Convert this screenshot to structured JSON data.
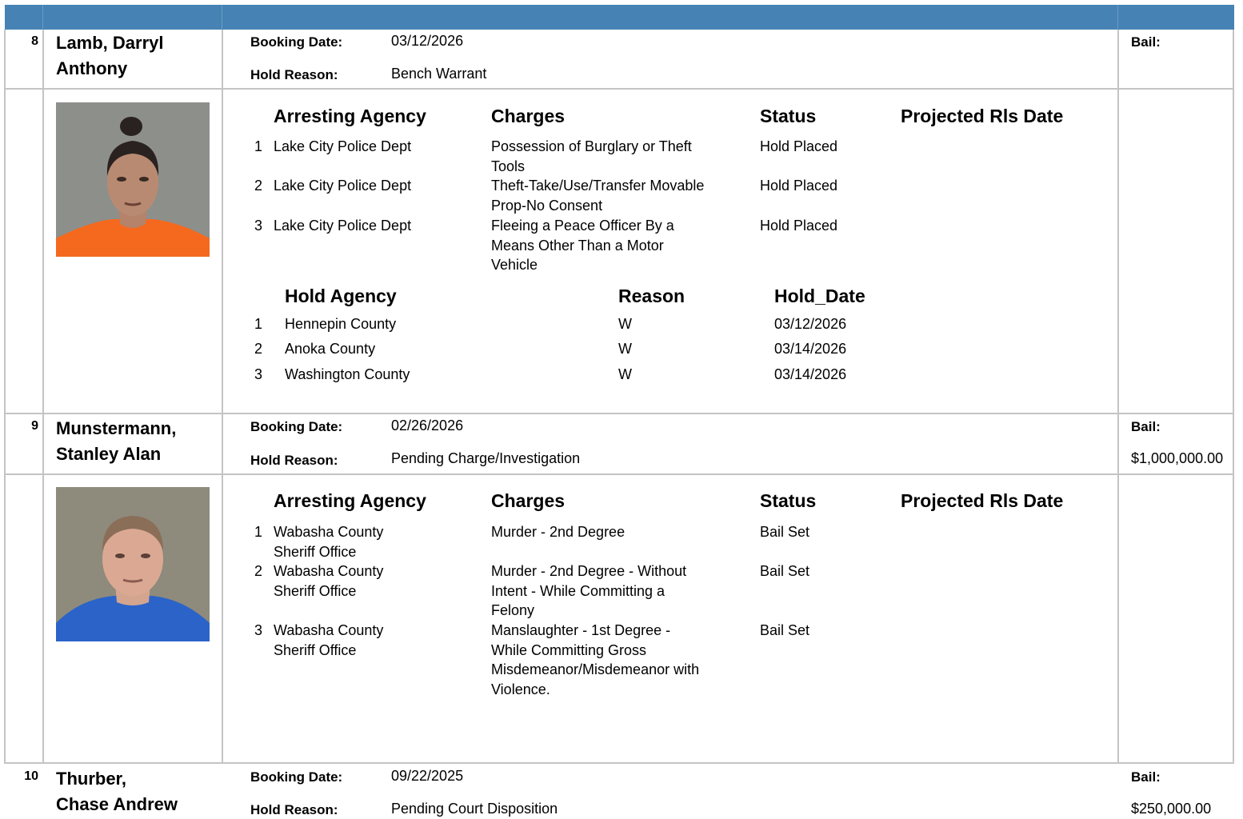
{
  "inmates": [
    {
      "number": "8",
      "name_line1": "Lamb, Darryl",
      "name_line2": "Anthony",
      "booking_date_label": "Booking Date:",
      "booking_date": "03/12/2026",
      "hold_reason_label": "Hold Reason:",
      "hold_reason": "Bench Warrant",
      "bail_label": "Bail:",
      "bail": "",
      "photo": "mugshot-orange-jumpsuit",
      "charges_headers": {
        "agency": "Arresting Agency",
        "charges": "Charges",
        "status": "Status",
        "release": "Projected Rls Date"
      },
      "charges": [
        {
          "n": "1",
          "agency": [
            "Lake City Police Dept"
          ],
          "charge": [
            "Possession of Burglary or Theft",
            "Tools"
          ],
          "status": "Hold Placed"
        },
        {
          "n": "2",
          "agency": [
            "Lake City Police Dept"
          ],
          "charge": [
            "Theft-Take/Use/Transfer Movable",
            "Prop-No Consent"
          ],
          "status": "Hold Placed"
        },
        {
          "n": "3",
          "agency": [
            "Lake City Police Dept"
          ],
          "charge": [
            "Fleeing a Peace Officer By a",
            "Means Other Than a Motor",
            "Vehicle"
          ],
          "status": "Hold Placed"
        }
      ],
      "holds_headers": {
        "agency": "Hold Agency",
        "reason": "Reason",
        "date": "Hold_Date"
      },
      "holds": [
        {
          "n": "1",
          "agency": "Hennepin County",
          "reason": "W",
          "date": "03/12/2026"
        },
        {
          "n": "2",
          "agency": "Anoka County",
          "reason": "W",
          "date": "03/14/2026"
        },
        {
          "n": "3",
          "agency": "Washington County",
          "reason": "W",
          "date": "03/14/2026"
        }
      ]
    },
    {
      "number": "9",
      "name_line1": "Munstermann,",
      "name_line2": "Stanley Alan",
      "booking_date_label": "Booking Date:",
      "booking_date": "02/26/2026",
      "hold_reason_label": "Hold Reason:",
      "hold_reason": "Pending Charge/Investigation",
      "bail_label": "Bail:",
      "bail": "$1,000,000.00",
      "photo": "mugshot-blue-shirt",
      "charges_headers": {
        "agency": "Arresting Agency",
        "charges": "Charges",
        "status": "Status",
        "release": "Projected Rls Date"
      },
      "charges": [
        {
          "n": "1",
          "agency": [
            "Wabasha County",
            "Sheriff Office"
          ],
          "charge": [
            "Murder - 2nd Degree"
          ],
          "status": "Bail Set"
        },
        {
          "n": "2",
          "agency": [
            "Wabasha County",
            "Sheriff Office"
          ],
          "charge": [
            "Murder - 2nd Degree - Without",
            "Intent - While Committing a",
            "Felony"
          ],
          "status": "Bail Set"
        },
        {
          "n": "3",
          "agency": [
            "Wabasha County",
            "Sheriff Office"
          ],
          "charge": [
            "Manslaughter - 1st Degree -",
            "While Committing Gross",
            "Misdemeanor/Misdemeanor with",
            "Violence."
          ],
          "status": "Bail Set"
        }
      ]
    },
    {
      "number": "10",
      "name_line1": "Thurber,",
      "name_line2": "Chase Andrew",
      "booking_date_label": "Booking Date:",
      "booking_date": "09/22/2025",
      "hold_reason_label": "Hold Reason:",
      "hold_reason": "Pending Court Disposition",
      "bail_label": "Bail:",
      "bail": "$250,000.00"
    }
  ]
}
